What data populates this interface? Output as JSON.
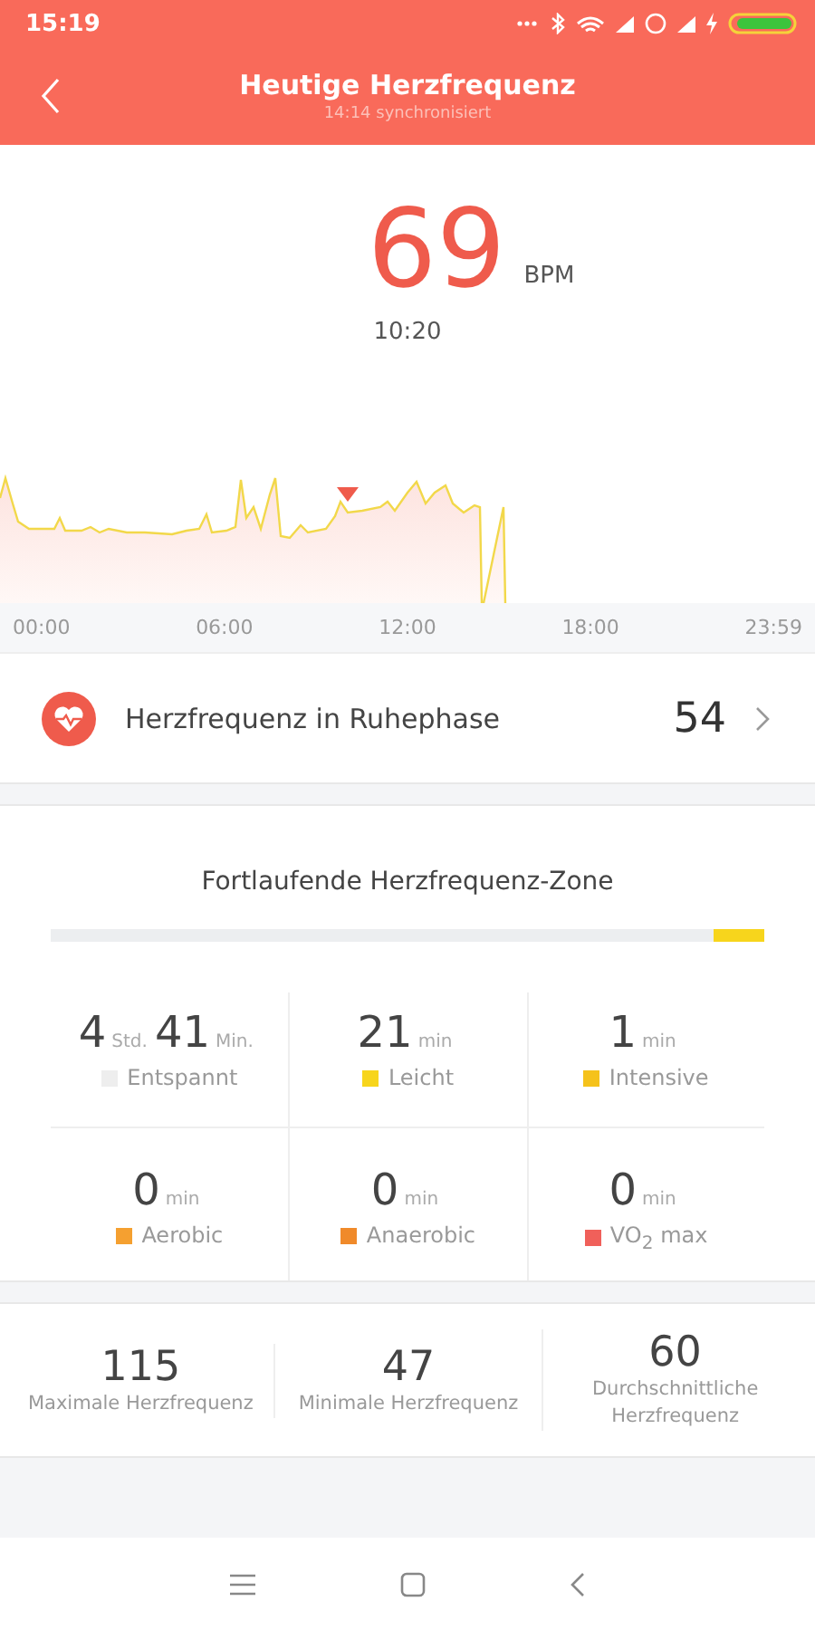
{
  "status_bar": {
    "time": "15:19"
  },
  "header": {
    "title": "Heutige Herzfrequenz",
    "subtitle": "14:14 synchronisiert"
  },
  "current": {
    "value": "69",
    "unit": "BPM",
    "time": "10:20"
  },
  "chart": {
    "x_labels": [
      "00:00",
      "06:00",
      "12:00",
      "18:00",
      "23:59"
    ]
  },
  "resting": {
    "label": "Herzfrequenz in Ruhephase",
    "value": "54"
  },
  "zones": {
    "title": "Fortlaufende Herzfrequenz-Zone",
    "level": 0.93,
    "items": [
      {
        "parts": [
          {
            "number": "4",
            "unit": "Std."
          },
          {
            "number": "41",
            "unit": "Min."
          }
        ],
        "label": "Entspannt",
        "color": "#eeeeee"
      },
      {
        "parts": [
          {
            "number": "21",
            "unit": "min"
          }
        ],
        "label": "Leicht",
        "color": "#f7d51c"
      },
      {
        "parts": [
          {
            "number": "1",
            "unit": "min"
          }
        ],
        "label": "Intensive",
        "color": "#f5c21b"
      },
      {
        "parts": [
          {
            "number": "0",
            "unit": "min"
          }
        ],
        "label": "Aerobic",
        "color": "#f5a030"
      },
      {
        "parts": [
          {
            "number": "0",
            "unit": "min"
          }
        ],
        "label": "Anaerobic",
        "color": "#f08a2a"
      },
      {
        "parts": [
          {
            "number": "0",
            "unit": "min"
          }
        ],
        "label": "VO$_{2}$ max",
        "color": "#f0605a"
      }
    ]
  },
  "stats": [
    {
      "value": "115",
      "label": "Maximale Herzfrequenz"
    },
    {
      "value": "47",
      "label": "Minimale Herzfrequenz"
    },
    {
      "value": "60",
      "label": "Durchschnittliche Herzfrequenz"
    }
  ]
}
